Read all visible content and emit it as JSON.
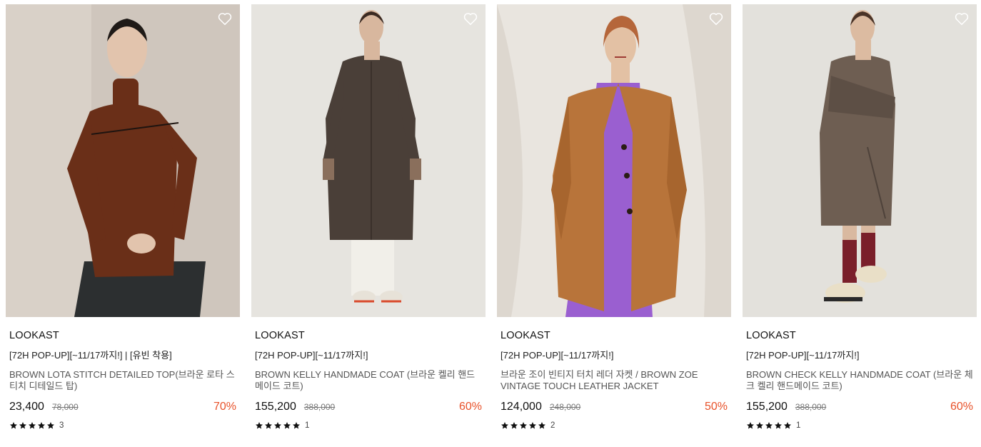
{
  "products": [
    {
      "brand": "LOOKAST",
      "tag": "[72H POP-UP][~11/17까지!] | [유빈 착용]",
      "name": "BROWN LOTA STITCH DETAILED TOP(브라운 로타 스티치 디테일드 탑)",
      "price": "23,400",
      "original_price": "78,000",
      "discount": "70%",
      "rating_stars": 5,
      "review_count": "3",
      "colors": {
        "bg": "#cfc6bd",
        "garment": "#6a2f18"
      }
    },
    {
      "brand": "LOOKAST",
      "tag": "[72H POP-UP][~11/17까지!]",
      "name": "BROWN KELLY HANDMADE COAT (브라운 켈리 핸드메이드 코트)",
      "price": "155,200",
      "original_price": "388,000",
      "discount": "60%",
      "rating_stars": 5,
      "review_count": "1",
      "colors": {
        "bg": "#e6e4df",
        "garment": "#4a3f38"
      }
    },
    {
      "brand": "LOOKAST",
      "tag": "[72H POP-UP][~11/17까지!]",
      "name": "브라운 조이 빈티지 터치 레더 자켓 / BROWN ZOE VINTAGE TOUCH LEATHER JACKET",
      "price": "124,000",
      "original_price": "248,000",
      "discount": "50%",
      "rating_stars": 5,
      "review_count": "2",
      "colors": {
        "bg": "#e9e5df",
        "garment": "#b8743a",
        "inner": "#9a5fd0"
      }
    },
    {
      "brand": "LOOKAST",
      "tag": "[72H POP-UP][~11/17까지!]",
      "name": "BROWN CHECK KELLY HANDMADE COAT (브라운 체크 켈리 핸드메이드 코트)",
      "price": "155,200",
      "original_price": "388,000",
      "discount": "60%",
      "rating_stars": 5,
      "review_count": "1",
      "colors": {
        "bg": "#e3e1dc",
        "garment": "#6e5e52"
      }
    }
  ],
  "icons": {
    "wishlist": "heart-outline-icon",
    "rating": "star-icon"
  },
  "accent_color": "#e8522a"
}
